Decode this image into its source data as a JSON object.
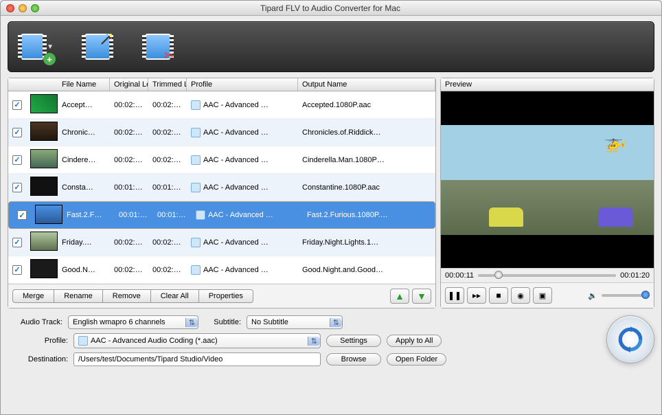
{
  "window": {
    "title": "Tipard FLV to Audio Converter for Mac"
  },
  "headers": {
    "fileName": "File Name",
    "original": "Original Le",
    "trimmed": "Trimmed L",
    "profile": "Profile",
    "output": "Output Name",
    "preview": "Preview"
  },
  "rows": [
    {
      "checked": true,
      "thumb": "t1",
      "name": "Accept…",
      "orig": "00:02:…",
      "trim": "00:02:…",
      "profile": "AAC - Advanced …",
      "out": "Accepted.1080P.aac",
      "alt": false,
      "sel": false
    },
    {
      "checked": true,
      "thumb": "t2",
      "name": "Chronic…",
      "orig": "00:02:…",
      "trim": "00:02:…",
      "profile": "AAC - Advanced …",
      "out": "Chronicles.of.Riddick…",
      "alt": true,
      "sel": false
    },
    {
      "checked": true,
      "thumb": "t3",
      "name": "Cindere…",
      "orig": "00:02:…",
      "trim": "00:02:…",
      "profile": "AAC - Advanced …",
      "out": "Cinderella.Man.1080P…",
      "alt": false,
      "sel": false
    },
    {
      "checked": true,
      "thumb": "t4",
      "name": "Consta…",
      "orig": "00:01:…",
      "trim": "00:01:…",
      "profile": "AAC - Advanced …",
      "out": "Constantine.1080P.aac",
      "alt": true,
      "sel": false
    },
    {
      "checked": true,
      "thumb": "t5",
      "name": "Fast.2.F…",
      "orig": "00:01:…",
      "trim": "00:01:…",
      "profile": "AAC - Advanced …",
      "out": "Fast.2.Furious.1080P.…",
      "alt": false,
      "sel": true
    },
    {
      "checked": true,
      "thumb": "t6",
      "name": "Friday.…",
      "orig": "00:02:…",
      "trim": "00:02:…",
      "profile": "AAC - Advanced …",
      "out": "Friday.Night.Lights.1…",
      "alt": true,
      "sel": false
    },
    {
      "checked": true,
      "thumb": "t7",
      "name": "Good.N…",
      "orig": "00:02:…",
      "trim": "00:02:…",
      "profile": "AAC - Advanced …",
      "out": "Good.Night.and.Good…",
      "alt": false,
      "sel": false
    }
  ],
  "listbar": {
    "merge": "Merge",
    "rename": "Rename",
    "remove": "Remove",
    "clearAll": "Clear All",
    "properties": "Properties"
  },
  "playback": {
    "cur": "00:00:11",
    "total": "00:01:20"
  },
  "form": {
    "audioTrackLabel": "Audio Track:",
    "audioTrack": "English wmapro 6 channels",
    "subtitleLabel": "Subtitle:",
    "subtitle": "No Subtitle",
    "profileLabel": "Profile:",
    "profile": "AAC - Advanced Audio Coding (*.aac)",
    "settings": "Settings",
    "applyAll": "Apply to All",
    "destLabel": "Destination:",
    "dest": "/Users/test/Documents/Tipard Studio/Video",
    "browse": "Browse",
    "openFolder": "Open Folder"
  }
}
